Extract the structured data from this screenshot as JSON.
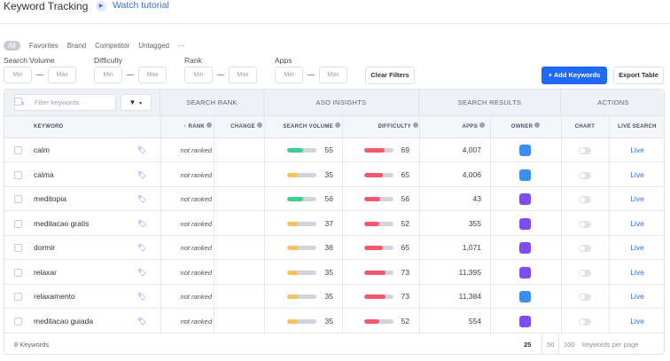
{
  "header": {
    "title": "Keyword Tracking",
    "tutorial_link": "Watch tutorial"
  },
  "tags": [
    "All",
    "Favorites",
    "Brand",
    "Competitor",
    "Untagged",
    "···"
  ],
  "filters": [
    {
      "label": "Search Volume",
      "min_placeholder": "Min",
      "max_placeholder": "Max"
    },
    {
      "label": "Difficulty",
      "min_placeholder": "Min",
      "max_placeholder": "Max"
    },
    {
      "label": "Rank",
      "min_placeholder": "Min",
      "max_placeholder": "Max"
    },
    {
      "label": "Apps",
      "min_placeholder": "Min",
      "max_placeholder": "Max"
    }
  ],
  "buttons": {
    "clear_filters": "Clear Filters",
    "add_keywords": "+ Add Keywords",
    "export_table": "Export Table"
  },
  "table": {
    "filter_placeholder": "Filter keywords",
    "groups": {
      "search_rank": "SEARCH RANK",
      "aso_insights": "ASO INSIGHTS",
      "search_results": "SEARCH RESULTS",
      "actions": "ACTIONS"
    },
    "columns": {
      "keyword": "KEYWORD",
      "rank": "↑ RANK",
      "change": "CHANGE",
      "search_volume": "SEARCH VOLUME",
      "difficulty": "DIFFICULTY",
      "apps": "APPS",
      "owner": "OWNER",
      "chart": "CHART",
      "live_search": "LIVE SEARCH"
    },
    "rows": [
      {
        "keyword": "calm",
        "rank": "not ranked",
        "change": "",
        "search_volume": 55,
        "difficulty": 69,
        "apps": "4,007",
        "owner": "calm",
        "live": "Live"
      },
      {
        "keyword": "calma",
        "rank": "not ranked",
        "change": "",
        "search_volume": 35,
        "difficulty": 65,
        "apps": "4,006",
        "owner": "calm",
        "live": "Live"
      },
      {
        "keyword": "meditopia",
        "rank": "not ranked",
        "change": "",
        "search_volume": 56,
        "difficulty": 56,
        "apps": "43",
        "owner": "meditopia",
        "live": "Live"
      },
      {
        "keyword": "meditacao gratis",
        "rank": "not ranked",
        "change": "",
        "search_volume": 37,
        "difficulty": 52,
        "apps": "355",
        "owner": "meditopia",
        "live": "Live"
      },
      {
        "keyword": "dormir",
        "rank": "not ranked",
        "change": "",
        "search_volume": 36,
        "difficulty": 65,
        "apps": "1,071",
        "owner": "meditopia",
        "live": "Live"
      },
      {
        "keyword": "relaxar",
        "rank": "not ranked",
        "change": "",
        "search_volume": 35,
        "difficulty": 73,
        "apps": "11,395",
        "owner": "meditopia",
        "live": "Live"
      },
      {
        "keyword": "relaxamento",
        "rank": "not ranked",
        "change": "",
        "search_volume": 35,
        "difficulty": 73,
        "apps": "11,384",
        "owner": "calm",
        "live": "Live"
      },
      {
        "keyword": "meditacao guiada",
        "rank": "not ranked",
        "change": "",
        "search_volume": 35,
        "difficulty": 52,
        "apps": "554",
        "owner": "meditopia",
        "live": "Live"
      }
    ]
  },
  "footer": {
    "count": "8 Keywords",
    "page_sizes": [
      "25",
      "50",
      "100"
    ],
    "per_page_label": "keywords per page"
  },
  "colors": {
    "accent": "#1f6af5",
    "volume_high": "#3ccf91",
    "volume_low": "#f9c35a",
    "difficulty": "#f2596e",
    "owner_calm": "#3a8ef0",
    "owner_meditopia": "#7b4df2"
  }
}
